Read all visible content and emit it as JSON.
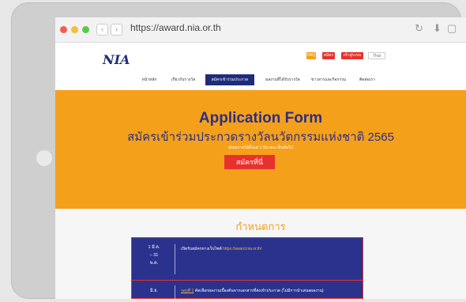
{
  "browser": {
    "url": "https://award.nia.or.th"
  },
  "header": {
    "logo": "NIA",
    "faq": "FAQ",
    "register": "สมัคร",
    "login": "เข้าสู่ระบบ",
    "lang": "Thai"
  },
  "nav": {
    "items": [
      {
        "label": "หน้าหลัก"
      },
      {
        "label": "เกี่ยวกับรางวัล"
      },
      {
        "label": "สมัครเข้าร่วมประกวด"
      },
      {
        "label": "ผลงานที่ได้รับรางวัล"
      },
      {
        "label": "ข่าวสารและกิจกรรม"
      },
      {
        "label": "ติดต่อเรา"
      }
    ]
  },
  "hero": {
    "title": "Application Form",
    "subtitle": "สมัครเข้าร่วมประกวดรางวัลนวัตกรรมแห่งชาติ 2565",
    "note": "ส่งผลงานได้ตั้งแต่ 1 มีนาคม เป็นต้นไป",
    "apply_label": "สมัครที่นี่"
  },
  "schedule": {
    "title": "กำหนดการ",
    "row1": {
      "date_line1": "1 มี.ค.",
      "date_line2": "– 31",
      "date_line3": "พ.ค.",
      "desc": "เปิดรับสมัครทางเว็บไซต์",
      "link": "https://award.nia.or.th/"
    },
    "row2": {
      "date": "มิ.ย.",
      "round": "รอบที่ 1",
      "desc": "คัดเลือกผลงานเบื้องต้นจากเอกสารที่ส่งเข้าประกวด (ไม่มีการนำเสนอผลงาน)"
    }
  }
}
